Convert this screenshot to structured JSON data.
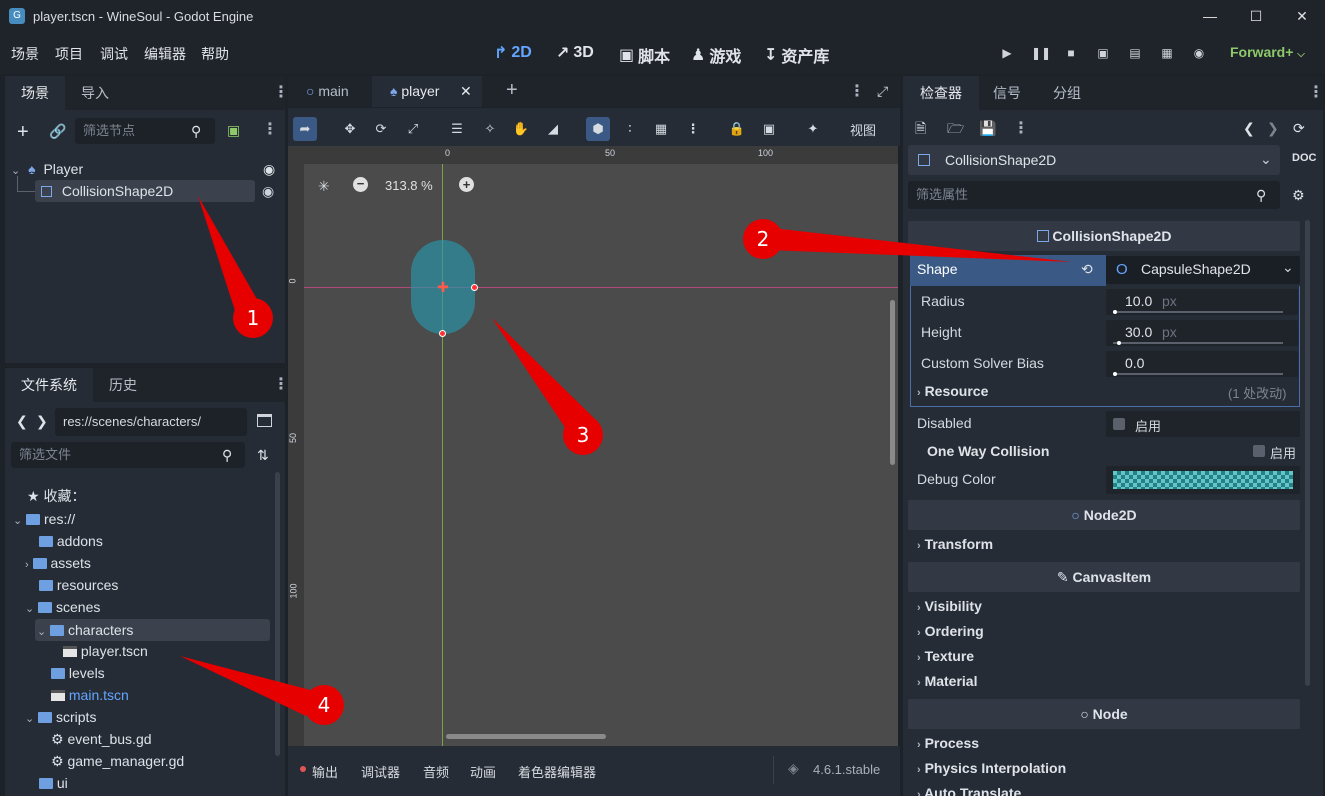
{
  "window": {
    "title": "player.tscn - WineSoul - Godot Engine"
  },
  "menu": [
    "场景",
    "项目",
    "调试",
    "编辑器",
    "帮助"
  ],
  "workspaces": [
    {
      "label": "2D",
      "icon": "2d-icon",
      "active": true
    },
    {
      "label": "3D",
      "icon": "3d-icon",
      "active": false
    },
    {
      "label": "脚本",
      "icon": "script-icon",
      "active": false
    },
    {
      "label": "游戏",
      "icon": "game-icon",
      "active": false
    },
    {
      "label": "资产库",
      "icon": "asset-library-icon",
      "active": false
    }
  ],
  "renderer": "Forward+",
  "scene_dock": {
    "tabs": [
      "场景",
      "导入"
    ],
    "filter_placeholder": "筛选节点",
    "nodes": [
      {
        "name": "Player"
      },
      {
        "name": "CollisionShape2D"
      }
    ]
  },
  "filesystem": {
    "tabs": [
      "文件系统",
      "历史"
    ],
    "path": "res://scenes/characters/",
    "filter_placeholder": "筛选文件",
    "favorites": "收藏：",
    "items": [
      "res://",
      "addons",
      "assets",
      "resources",
      "scenes",
      "characters",
      "player.tscn",
      "levels",
      "main.tscn",
      "scripts",
      "event_bus.gd",
      "game_manager.gd",
      "ui"
    ]
  },
  "editor": {
    "tabs": [
      "main",
      "player"
    ],
    "zoom": "313.8 %",
    "view_label": "视图",
    "ruler_top": [
      "0",
      "50",
      "100"
    ],
    "ruler_left": [
      "0",
      "50",
      "100"
    ]
  },
  "bottom_panel": {
    "tabs": [
      "输出",
      "调试器",
      "音频",
      "动画",
      "着色器编辑器"
    ],
    "version": "4.6.1.stable"
  },
  "inspector": {
    "tabs": [
      "检查器",
      "信号",
      "分组"
    ],
    "node_selector": "CollisionShape2D",
    "filter_placeholder": "筛选属性",
    "section_collision": "CollisionShape2D",
    "shape_label": "Shape",
    "shape_value": "CapsuleShape2D",
    "radius_label": "Radius",
    "radius_value": "10.0",
    "height_label": "Height",
    "height_value": "30.0",
    "unit": "px",
    "bias_label": "Custom Solver Bias",
    "bias_value": "0.0",
    "resource_label": "Resource",
    "resource_changes": "(1 处改动)",
    "disabled_label": "Disabled",
    "enable_label": "启用",
    "oneway_label": "One Way Collision",
    "debug_label": "Debug Color",
    "section_node2d": "Node2D",
    "transform": "Transform",
    "section_canvas": "CanvasItem",
    "canvas_items": [
      "Visibility",
      "Ordering",
      "Texture",
      "Material"
    ],
    "section_node": "Node",
    "node_items": [
      "Process",
      "Physics Interpolation",
      "Auto Translate"
    ]
  },
  "annotations": [
    "1",
    "2",
    "3",
    "4"
  ],
  "colors": {
    "accent": "#63a6ff",
    "selection": "#3a5a85",
    "marker": "#e60000",
    "capsule": "#3a8d9c"
  }
}
